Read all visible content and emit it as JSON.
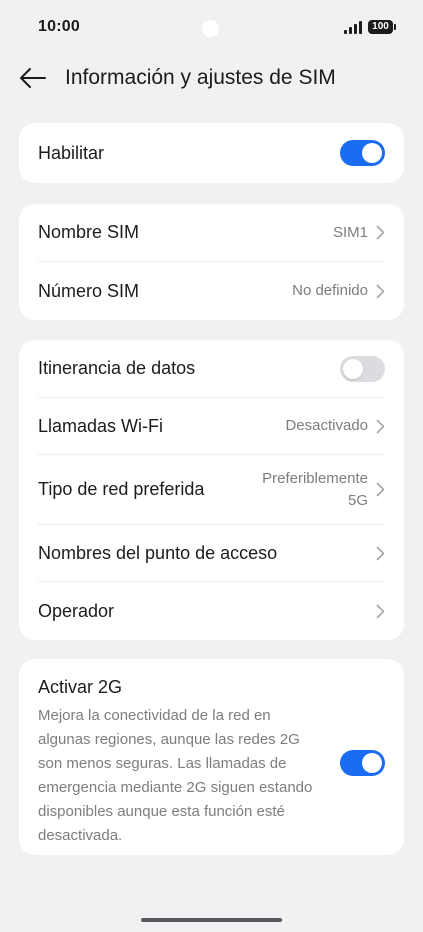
{
  "status_bar": {
    "time": "10:00",
    "battery": "100",
    "icons": [
      "signal-icon",
      "battery-icon"
    ]
  },
  "header": {
    "back_icon": "arrow-left-icon",
    "title": "Información y ajustes de SIM"
  },
  "enable_card": {
    "label": "Habilitar",
    "enabled": true
  },
  "sim_card": {
    "items": [
      {
        "label": "Nombre SIM",
        "value": "SIM1"
      },
      {
        "label": "Número SIM",
        "value": "No definido"
      }
    ]
  },
  "network_card": {
    "data_roaming": {
      "label": "Itinerancia de datos",
      "enabled": false
    },
    "wifi_calls": {
      "label": "Llamadas Wi-Fi",
      "value": "Desactivado"
    },
    "preferred_network": {
      "label": "Tipo de red preferida",
      "value_line1": "Preferiblemente",
      "value_line2": "5G"
    },
    "apn": {
      "label": "Nombres del punto de acceso"
    },
    "operator": {
      "label": "Operador"
    }
  },
  "activate_2g": {
    "title": "Activar 2G",
    "description": "Mejora la conectividad de la red en algunas regiones, aunque las redes 2G son menos seguras. Las llamadas de emergencia mediante 2G siguen estando disponibles aunque esta función esté desactivada.",
    "enabled": true
  },
  "colors": {
    "background": "#f1f1f3",
    "card": "#ffffff",
    "accent": "#1a6df2",
    "secondary_text": "#7d7d82",
    "toggle_off": "#dcdce0"
  }
}
